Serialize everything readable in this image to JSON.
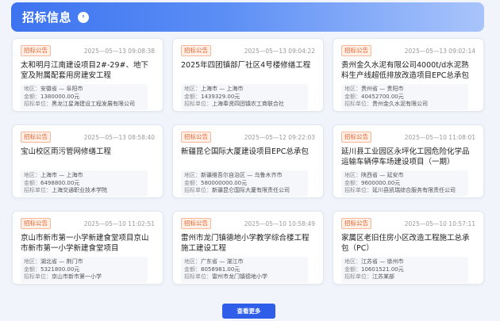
{
  "header": {
    "title": "招标信息",
    "arrow_icon": "chevron-right-icon"
  },
  "labels": {
    "region": "地区：",
    "amount": "金额：",
    "unit": "招标单位："
  },
  "cards": [
    {
      "tag": "招标公告",
      "date": "2025—05—13 09:08:38",
      "title": "太和明月江南建设项目2#-29#、地下室及附属配套用房建安工程",
      "region": "安徽省 — 阜阳市",
      "amount": "1380000.00元",
      "unit": "黑龙江星海建设工程发展有限公司"
    },
    {
      "tag": "招标公告",
      "date": "2025—05—13 09:04:22",
      "title": "2025年四团镇部厂社区4号楼修缮工程",
      "region": "上海市 — 上海市",
      "amount": "1439329.00元",
      "unit": "上海奉贤四团镇农工商联合社"
    },
    {
      "tag": "招标公告",
      "date": "2025—05—13 09:02:14",
      "title": "贵州金久水泥有限公司4000t/d水泥熟料生产线超低排放改造项目EPC总承包",
      "region": "贵州省 — 贵阳市",
      "amount": "40452700.00元",
      "unit": "贵州金久水泥有限公司"
    },
    {
      "tag": "招标公告",
      "date": "2025—05—13 08:58:40",
      "title": "宝山校区雨污管网修缮工程",
      "region": "上海市 — 上海市",
      "amount": "6498800.00元",
      "unit": "上海交通职业技术学院"
    },
    {
      "tag": "招标公告",
      "date": "2025—05—12 09:22:03",
      "title": "新疆昆仑国际大厦建设项目EPC总承包",
      "region": "新疆维吾尔自治区 — 乌鲁木齐市",
      "amount": "580000000.00元",
      "unit": "新疆昆仑国际大厦有限责任公司"
    },
    {
      "tag": "招标公告",
      "date": "2025—05—10 11:08:01",
      "title": "延川县工业园区永坪化工园危险化学品运输车辆停车场建设项目（一期）",
      "region": "陕西省 — 延安市",
      "amount": "9600000.00元",
      "unit": "延川县凯瑞综合服务有限责任公司"
    },
    {
      "tag": "招标公告",
      "date": "2025—05—10 11:02:51",
      "title": "京山市新市第一小学新建食堂项目京山市新市第一小学新建食堂项目",
      "region": "湖北省 — 荆门市",
      "amount": "5321800.00元",
      "unit": "京山市新市第一小学"
    },
    {
      "tag": "招标公告",
      "date": "2025—05—10 10:58:49",
      "title": "雷州市龙门镇德地小学教学综合楼工程施工建设工程",
      "region": "广东省 — 湛江市",
      "amount": "8058981.00元",
      "unit": "雷州市龙门镇德地小学"
    },
    {
      "tag": "招标公告",
      "date": "2025—05—10 10:57:11",
      "title": "家属区老旧住房小区改造工程施工总承包（PC）",
      "region": "江苏省 — 徐州市",
      "amount": "10601521.00元",
      "unit": "江苏某部"
    }
  ],
  "more_button": "查看更多"
}
